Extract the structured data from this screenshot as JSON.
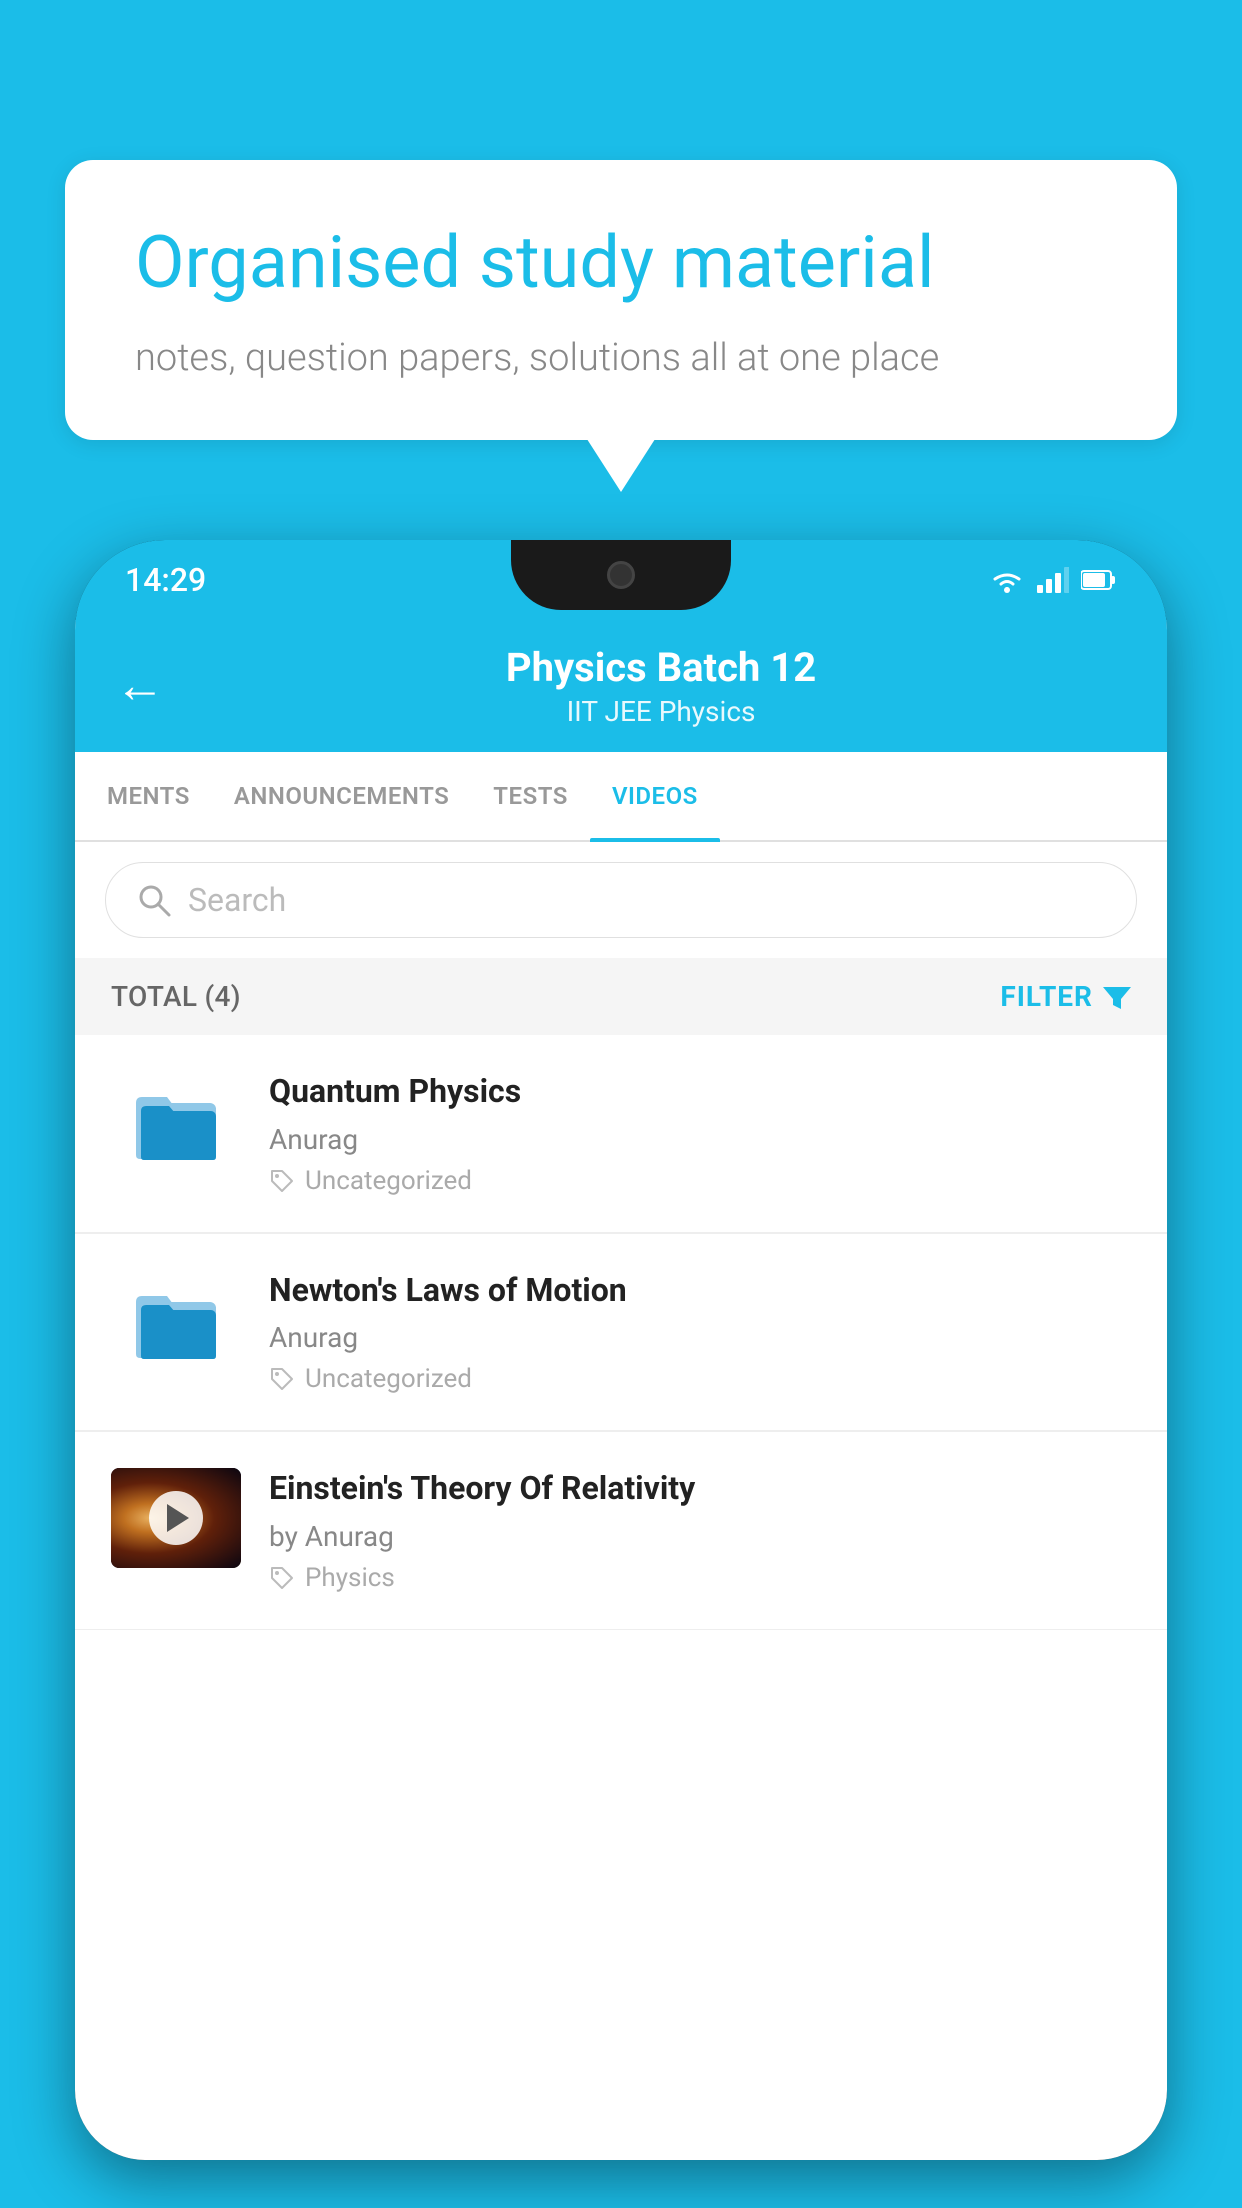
{
  "background": {
    "color": "#1bbde8"
  },
  "speech_bubble": {
    "title": "Organised study material",
    "subtitle": "notes, question papers, solutions all at one place"
  },
  "status_bar": {
    "time": "14:29"
  },
  "app_header": {
    "back_label": "←",
    "title": "Physics Batch 12",
    "subtitle": "IIT JEE   Physics"
  },
  "tabs": [
    {
      "label": "MENTS",
      "active": false
    },
    {
      "label": "ANNOUNCEMENTS",
      "active": false
    },
    {
      "label": "TESTS",
      "active": false
    },
    {
      "label": "VIDEOS",
      "active": true
    }
  ],
  "search": {
    "placeholder": "Search"
  },
  "filter_bar": {
    "total_label": "TOTAL (4)",
    "filter_label": "FILTER"
  },
  "videos": [
    {
      "title": "Quantum Physics",
      "author": "Anurag",
      "tag": "Uncategorized",
      "has_thumbnail": false
    },
    {
      "title": "Newton's Laws of Motion",
      "author": "Anurag",
      "tag": "Uncategorized",
      "has_thumbnail": false
    },
    {
      "title": "Einstein's Theory Of Relativity",
      "author": "by Anurag",
      "tag": "Physics",
      "has_thumbnail": true
    }
  ]
}
